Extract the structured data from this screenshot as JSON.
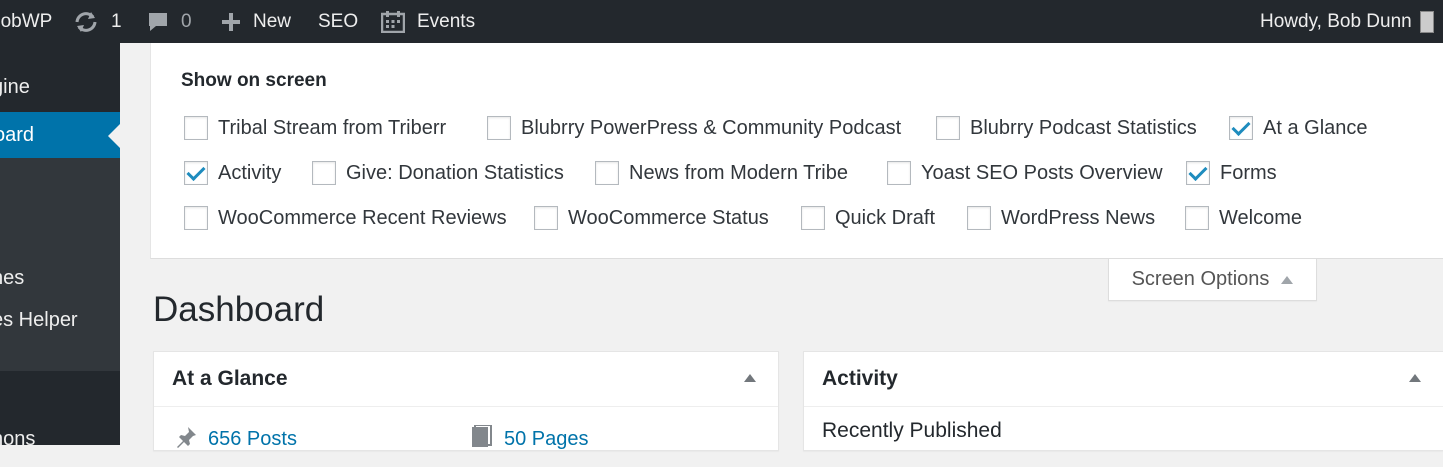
{
  "adminbar": {
    "site_name": "bobWP",
    "updates_count": "1",
    "comments_count": "0",
    "new_label": "New",
    "seo_label": "SEO",
    "events_label": "Events",
    "howdy": "Howdy, Bob Dunn",
    "icons": [
      "updates-icon",
      "comment-icon",
      "plus-icon",
      "calendar-icon",
      "avatar"
    ]
  },
  "sidebar": {
    "items": [
      {
        "label": "gine"
      },
      {
        "label": "oard",
        "current": true
      },
      {
        "label": "nes"
      },
      {
        "label": "es Helper"
      },
      {
        "label": "nons"
      }
    ]
  },
  "screen_options": {
    "heading": "Show on screen",
    "options": [
      {
        "label": "Tribal Stream from Triberr",
        "checked": false
      },
      {
        "label": "Blubrry PowerPress & Community Podcast",
        "checked": false
      },
      {
        "label": "Blubrry Podcast Statistics",
        "checked": false
      },
      {
        "label": "At a Glance",
        "checked": true
      },
      {
        "label": "Activity",
        "checked": true
      },
      {
        "label": "Give: Donation Statistics",
        "checked": false
      },
      {
        "label": "News from Modern Tribe",
        "checked": false
      },
      {
        "label": "Yoast SEO Posts Overview",
        "checked": false
      },
      {
        "label": "Forms",
        "checked": true
      },
      {
        "label": "WooCommerce Recent Reviews",
        "checked": false
      },
      {
        "label": "WooCommerce Status",
        "checked": false
      },
      {
        "label": "Quick Draft",
        "checked": false
      },
      {
        "label": "WordPress News",
        "checked": false
      },
      {
        "label": "Welcome",
        "checked": false
      }
    ],
    "tab_label": "Screen Options"
  },
  "page": {
    "title": "Dashboard"
  },
  "glance": {
    "title": "At a Glance",
    "posts": "656 Posts",
    "pages": "50 Pages"
  },
  "activity": {
    "title": "Activity",
    "recently_published": "Recently Published"
  },
  "colors": {
    "adminbar": "#23282d",
    "accent": "#0073aa",
    "checkmark": "#1e8cbe"
  }
}
